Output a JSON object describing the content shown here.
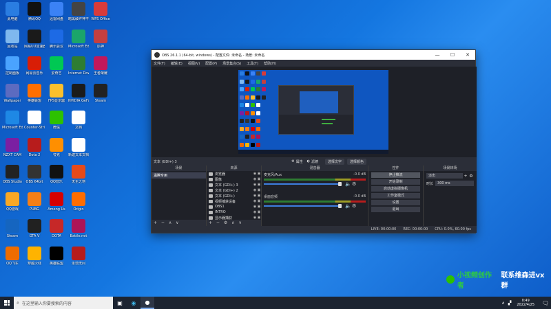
{
  "desktop": {
    "icons": [
      {
        "label": "此电脑",
        "color": "#2a7de1",
        "col": 0,
        "row": 0
      },
      {
        "label": "腾讯QQ",
        "color": "#111111",
        "col": 1,
        "row": 0
      },
      {
        "label": "迅雷网盘",
        "color": "#3b82f6",
        "col": 2,
        "row": 0
      },
      {
        "label": "暗黑破坏神不朽",
        "color": "#444444",
        "col": 3,
        "row": 0
      },
      {
        "label": "WPS Office",
        "color": "#d83b3b",
        "col": 4,
        "row": 0
      },
      {
        "label": "回收站",
        "color": "#7fb8ee",
        "col": 0,
        "row": 1
      },
      {
        "label": "网易UU加速器",
        "color": "#1a1a1a",
        "col": 1,
        "row": 1
      },
      {
        "label": "腾讯会议",
        "color": "#1d6ae5",
        "col": 2,
        "row": 1
      },
      {
        "label": "Microsoft Edge",
        "color": "#1ba56a",
        "col": 3,
        "row": 1
      },
      {
        "label": "原神",
        "color": "#c43f3f",
        "col": 4,
        "row": 1
      },
      {
        "label": "控制面板",
        "color": "#4aa3ff",
        "col": 0,
        "row": 2
      },
      {
        "label": "网易云音乐",
        "color": "#d81e06",
        "col": 1,
        "row": 2
      },
      {
        "label": "爱奇艺",
        "color": "#00c853",
        "col": 2,
        "row": 2
      },
      {
        "label": "Internet Download Manager",
        "color": "#2e7d32",
        "col": 3,
        "row": 2
      },
      {
        "label": "王者荣耀",
        "color": "#c2185b",
        "col": 4,
        "row": 2
      },
      {
        "label": "Wallpaper",
        "color": "#5c6bc0",
        "col": 0,
        "row": 3
      },
      {
        "label": "英雄联盟",
        "color": "#ff6f00",
        "col": 1,
        "row": 3
      },
      {
        "label": "FPS显示器",
        "color": "#fbc02d",
        "col": 2,
        "row": 3
      },
      {
        "label": "NVIDIA GeForce",
        "color": "#1b1b1b",
        "col": 3,
        "row": 3
      },
      {
        "label": "Steam",
        "color": "#222222",
        "col": 4,
        "row": 3
      },
      {
        "label": "Microsoft Edge",
        "color": "#1e88e5",
        "col": 0,
        "row": 4
      },
      {
        "label": "Counter-Strike",
        "color": "#ffffff",
        "col": 1,
        "row": 4
      },
      {
        "label": "微信",
        "color": "#2dc100",
        "col": 2,
        "row": 4
      },
      {
        "label": "文档",
        "color": "#ffffff",
        "col": 3,
        "row": 4
      },
      {
        "label": "NZXT CAM",
        "color": "#7b1fa2",
        "col": 0,
        "row": 5
      },
      {
        "label": "Dota 2",
        "color": "#b71c1c",
        "col": 1,
        "row": 5
      },
      {
        "label": "夸克",
        "color": "#ff8f00",
        "col": 2,
        "row": 5
      },
      {
        "label": "新建文本文档",
        "color": "#ffffff",
        "col": 3,
        "row": 5
      },
      {
        "label": "OBS Studio",
        "color": "#222222",
        "col": 0,
        "row": 6
      },
      {
        "label": "OBS 64bit",
        "color": "#333333",
        "col": 1,
        "row": 6
      },
      {
        "label": "QQ音乐",
        "color": "#111111",
        "col": 2,
        "row": 6
      },
      {
        "label": "无主之地",
        "color": "#e64a19",
        "col": 3,
        "row": 6
      },
      {
        "label": "QQ游戏",
        "color": "#f9a825",
        "col": 0,
        "row": 7
      },
      {
        "label": "PUBG",
        "color": "#f57f17",
        "col": 1,
        "row": 7
      },
      {
        "label": "Among Us",
        "color": "#d50000",
        "col": 2,
        "row": 7
      },
      {
        "label": "Origin",
        "color": "#ff6d00",
        "col": 3,
        "row": 7
      },
      {
        "label": "Steam",
        "color": "#1565c0",
        "col": 0,
        "row": 8
      },
      {
        "label": "GTA V",
        "color": "#212121",
        "col": 1,
        "row": 8
      },
      {
        "label": "DOTA",
        "color": "#c62828",
        "col": 2,
        "row": 8
      },
      {
        "label": "Battle.net",
        "color": "#ad1457",
        "col": 3,
        "row": 8
      },
      {
        "label": "QQ飞车",
        "color": "#ef6c00",
        "col": 0,
        "row": 9
      },
      {
        "label": "穿越火线",
        "color": "#ffb300",
        "col": 1,
        "row": 9
      },
      {
        "label": "英雄联盟",
        "color": "#000000",
        "col": 2,
        "row": 9
      },
      {
        "label": "永劫无间",
        "color": "#b71c1c",
        "col": 3,
        "row": 9
      }
    ]
  },
  "obs": {
    "title": "OBS 26.1.1 (64-bit, windows) - 配置文件: 未命名 - 场景: 未命名",
    "menu": [
      "文件(F)",
      "编辑(E)",
      "视图(V)",
      "配置(P)",
      "场景集合(S)",
      "工具(T)",
      "帮助(H)"
    ],
    "scene_bar": {
      "current": "文本 (GDI+) 3",
      "properties": "属性",
      "filters": "滤镜",
      "select_text": "选择文字",
      "select_color": "选择颜色"
    },
    "docks": {
      "scenes": {
        "title": "场景",
        "items": [
          "温腾专用"
        ]
      },
      "sources": {
        "title": "来源",
        "items": [
          "浏览器",
          "图像",
          "文本 (GDI+) 3",
          "文本 (GDI+) 2",
          "文本 (GDI+)",
          "视频捕获设备",
          "OBS1",
          "INTRO",
          "显示器捕获"
        ]
      },
      "mixer": {
        "title": "混音器",
        "tracks": [
          {
            "name": "麦克风/Aux",
            "level": "-0.0 dB"
          },
          {
            "name": "桌面音频",
            "level": "-0.0 dB"
          }
        ]
      },
      "controls": {
        "title": "控件",
        "buttons": [
          "停止推流",
          "开始录制",
          "启动虚拟摄像机",
          "工作室模式",
          "设置",
          "退出"
        ]
      },
      "transitions": {
        "title": "场景转场",
        "type": "淡出",
        "duration_label": "时长",
        "duration": "300 ms"
      }
    },
    "status": {
      "live": "LIVE: 00:00:00",
      "rec": "REC: 00:00:00",
      "cpu": "CPU: 0.0%, 60.00 fps"
    }
  },
  "watermark": {
    "green": "小视频创作者",
    "white": "联系维森进vx群"
  },
  "taskbar": {
    "search_placeholder": "在这里输入你要搜索的内容",
    "time": "0:49",
    "date": "2022/4/25"
  }
}
